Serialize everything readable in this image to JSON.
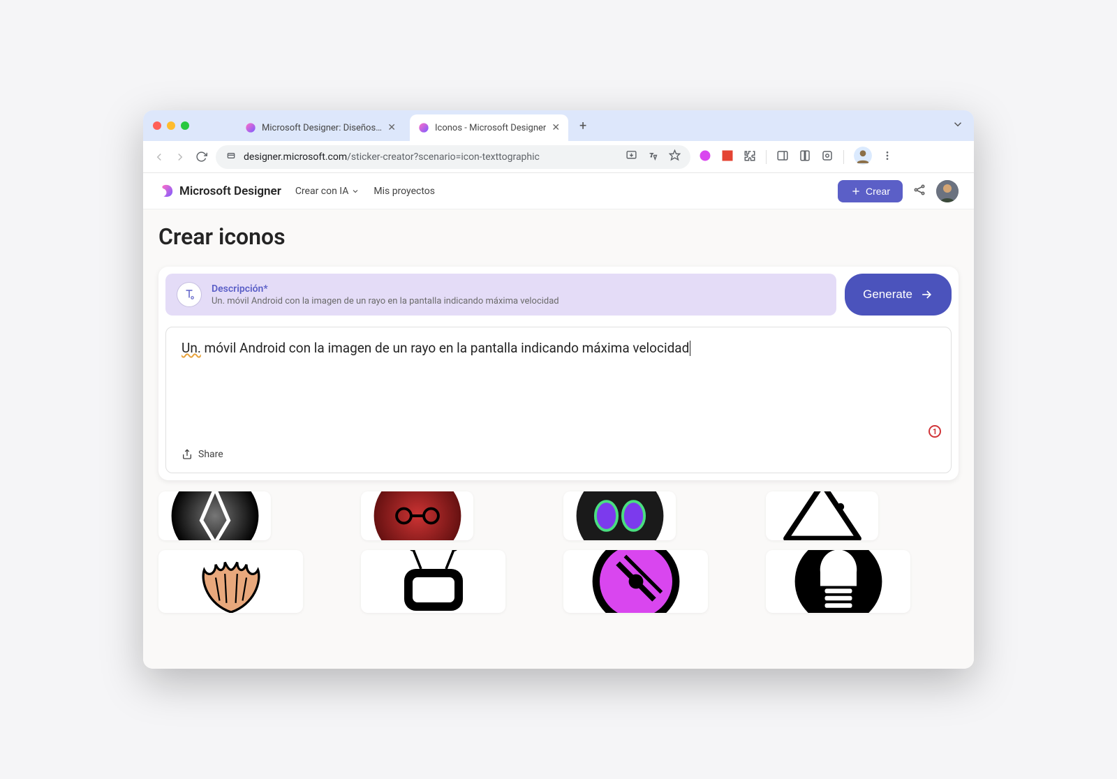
{
  "browser": {
    "tabs": [
      {
        "title": "Microsoft Designer: Diseños s",
        "active": false
      },
      {
        "title": "Iconos - Microsoft Designer",
        "active": true
      }
    ],
    "url_domain": "designer.microsoft.com",
    "url_path": "/sticker-creator?scenario=icon-texttographic"
  },
  "app": {
    "brand": "Microsoft Designer",
    "nav": {
      "create_ai": "Crear con IA",
      "my_projects": "Mis proyectos"
    },
    "create_button": "Crear"
  },
  "page": {
    "title": "Crear iconos"
  },
  "prompt": {
    "label": "Descripción*",
    "preview": "Un. móvil Android con la imagen de un rayo en la pantalla indicando máxima velocidad",
    "generate_button": "Generate",
    "input_prefix": "Un.",
    "input_rest": " móvil Android con la imagen de un rayo en la pantalla indicando máxima velocidad",
    "share": "Share",
    "badge": "1"
  }
}
